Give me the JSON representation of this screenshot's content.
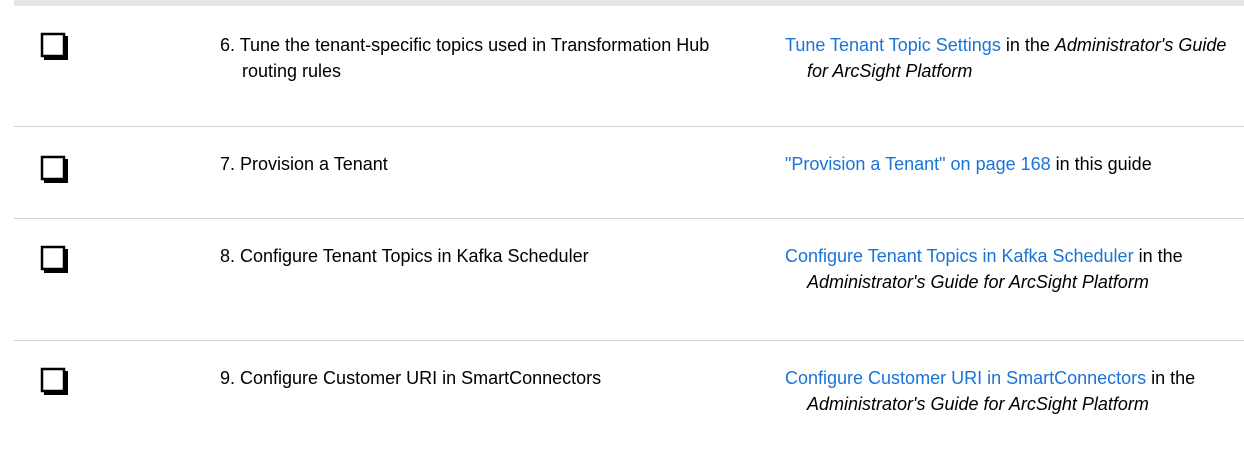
{
  "rows": [
    {
      "step": "6. Tune the tenant-specific topics used in Transformation Hub routing rules",
      "link": "Tune Tenant Topic Settings",
      "connector": " in the ",
      "italic": "Administrator's Guide for ArcSight Platform",
      "suffix": ""
    },
    {
      "step": "7. Provision a Tenant",
      "link": "\"Provision a Tenant\" on page 168",
      "connector": " in this guide",
      "italic": "",
      "suffix": ""
    },
    {
      "step": "8. Configure Tenant Topics in Kafka Scheduler",
      "link": "Configure Tenant Topics in Kafka Scheduler",
      "connector": " in the ",
      "italic": "Administrator's Guide for ArcSight Platform",
      "suffix": ""
    },
    {
      "step": "9. Configure Customer URI in SmartConnectors",
      "link": "Configure Customer URI in SmartConnectors",
      "connector": " in the ",
      "italic": "Administrator's Guide for ArcSight Platform",
      "suffix": ""
    }
  ],
  "colors": {
    "link": "#1a73d9",
    "rule": "#cfcfcf",
    "top_border": "#e6e6e6"
  },
  "icons": {
    "checkbox": "checkbox-icon"
  }
}
